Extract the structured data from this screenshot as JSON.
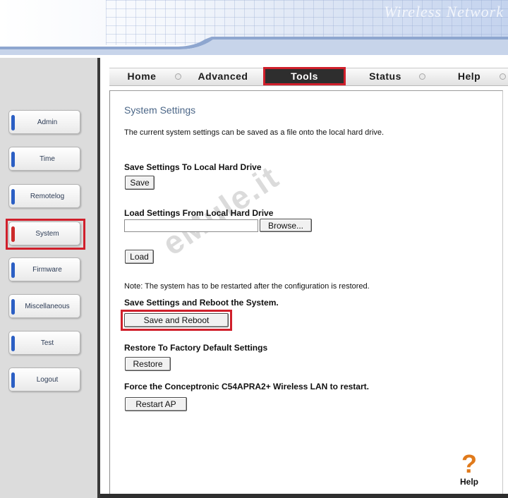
{
  "banner": {
    "text": "Wireless Network"
  },
  "sidebar": {
    "items": [
      {
        "label": "Admin"
      },
      {
        "label": "Time"
      },
      {
        "label": "Remotelog"
      },
      {
        "label": "System"
      },
      {
        "label": "Firmware"
      },
      {
        "label": "Miscellaneous"
      },
      {
        "label": "Test"
      },
      {
        "label": "Logout"
      }
    ],
    "active": "System"
  },
  "nav": {
    "items": [
      {
        "label": "Home"
      },
      {
        "label": "Advanced"
      },
      {
        "label": "Tools"
      },
      {
        "label": "Status"
      },
      {
        "label": "Help"
      }
    ],
    "active": "Tools"
  },
  "content": {
    "title": "System Settings",
    "description": "The current system settings can be saved as a file onto the local hard drive.",
    "save_section": {
      "heading": "Save Settings To Local Hard Drive",
      "button": "Save"
    },
    "load_section": {
      "heading": "Load Settings From Local Hard Drive",
      "file_value": "",
      "browse_button": "Browse...",
      "load_button": "Load"
    },
    "note": "Note: The system has to be restarted after the configuration is restored.",
    "reboot_section": {
      "heading": "Save Settings and Reboot the System.",
      "button": "Save and Reboot"
    },
    "factory_section": {
      "heading": "Restore To Factory Default Settings",
      "button": "Restore"
    },
    "restart_section": {
      "heading": "Force the Conceptronic C54APRA2+ Wireless LAN to restart.",
      "button": "Restart AP"
    }
  },
  "watermark": "eMule.it",
  "help_widget": {
    "label": "Help"
  },
  "colors": {
    "highlight": "#d01f2b",
    "active_tab": "#cc2a2a",
    "tab_blue": "#2b5fc4",
    "title": "#4c6788",
    "help_icon": "#e07a1b"
  }
}
